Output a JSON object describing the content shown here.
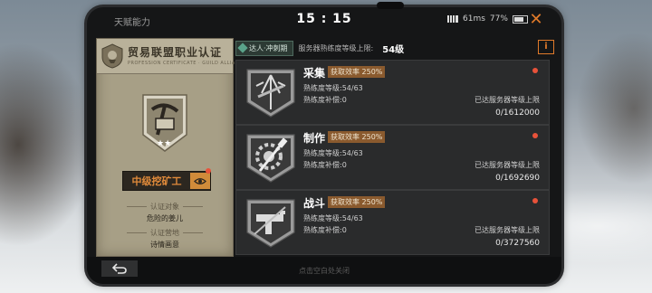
{
  "status": {
    "app_name": "天赋能力",
    "time": "15 : 15",
    "signal_text": "61ms",
    "battery": "77%"
  },
  "card": {
    "title": "贸易联盟职业认证",
    "subtitle": "PROFESSION CERTIFICATE · GUILD ALLIANCE",
    "rank": "中级挖矿工",
    "stars": "★★",
    "cert_target_label": "认证对象",
    "cert_target_value": "危险的姜儿",
    "cert_place_label": "认证营地",
    "cert_place_value": "诗情画意"
  },
  "topbar": {
    "talent_tag": "达人·冲刺期",
    "cap_label": "服务器熟练度等级上限:",
    "cap_value": "54级",
    "info_icon": "i"
  },
  "skills": [
    {
      "name": "采集",
      "efficiency": "获取效率 250%",
      "level": "熟练度等级:54/63",
      "compensation": "熟练度补偿:0",
      "status": "已达服务器等级上限",
      "xp": "0/1612000",
      "icon": "gathering-icon"
    },
    {
      "name": "制作",
      "efficiency": "获取效率 250%",
      "level": "熟练度等级:54/63",
      "compensation": "熟练度补偿:0",
      "status": "已达服务器等级上限",
      "xp": "0/1692690",
      "icon": "crafting-icon"
    },
    {
      "name": "战斗",
      "efficiency": "获取效率 250%",
      "level": "熟练度等级:54/63",
      "compensation": "熟练度补偿:0",
      "status": "已达服务器等级上限",
      "xp": "0/3727560",
      "icon": "combat-icon"
    }
  ],
  "bottom": {
    "hint": "点击空白处关闭"
  },
  "colors": {
    "accent": "#e07a2a",
    "badge": "#8a5a2e",
    "dot": "#e8523a"
  }
}
